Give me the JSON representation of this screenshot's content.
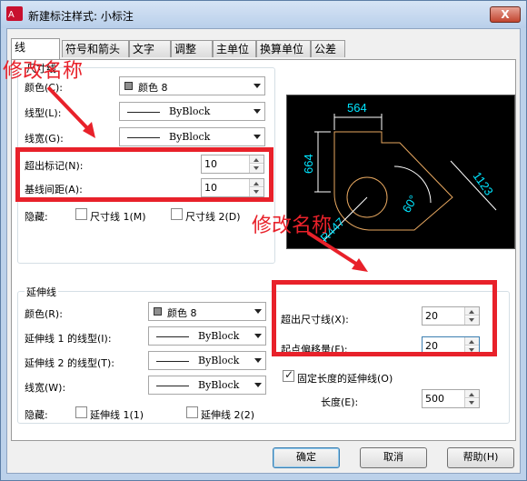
{
  "window": {
    "title": "新建标注样式: 小标注",
    "close_label": "X"
  },
  "tabs": [
    "线",
    "符号和箭头",
    "文字",
    "调整",
    "主单位",
    "换算单位",
    "公差"
  ],
  "dim_lines": {
    "group_label": "尺寸线",
    "color_label": "颜色(C):",
    "color_value": "颜色 8",
    "linetype_label": "线型(L):",
    "linetype_value": "ByBlock",
    "lineweight_label": "线宽(G):",
    "lineweight_value": "ByBlock",
    "extend_ticks_label": "超出标记(N):",
    "extend_ticks_value": "10",
    "baseline_spacing_label": "基线间距(A):",
    "baseline_spacing_value": "10",
    "suppress_label": "隐藏:",
    "suppress_1": "尺寸线 1(M)",
    "suppress_2": "尺寸线 2(D)"
  },
  "ext_lines": {
    "group_label": "延伸线",
    "color_label": "颜色(R):",
    "color_value": "颜色 8",
    "linetype1_label": "延伸线 1 的线型(I):",
    "linetype1_value": "ByBlock",
    "linetype2_label": "延伸线 2 的线型(T):",
    "linetype2_value": "ByBlock",
    "lineweight_label": "线宽(W):",
    "lineweight_value": "ByBlock",
    "suppress_label": "隐藏:",
    "suppress_1": "延伸线 1(1)",
    "suppress_2": "延伸线 2(2)",
    "extend_beyond_label": "超出尺寸线(X):",
    "extend_beyond_value": "20",
    "offset_label": "起点偏移量(F):",
    "offset_value": "20",
    "fixed_length_label": "固定长度的延伸线(O)",
    "fixed_length_checked": true,
    "length_label": "长度(E):",
    "length_value": "500"
  },
  "preview": {
    "dim_top": "564",
    "dim_left": "664",
    "dim_diag": "1123",
    "angle": "60°",
    "radius": "R447"
  },
  "annotations": {
    "note_1": "修改名称",
    "note_2": "修改名称"
  },
  "buttons": {
    "ok": "确定",
    "cancel": "取消",
    "help": "帮助(H)"
  },
  "colors": {
    "annotation_red": "#e8212a",
    "preview_white": "#ffffff",
    "preview_cyan": "#00e5ff",
    "preview_orange": "#e8a860"
  }
}
